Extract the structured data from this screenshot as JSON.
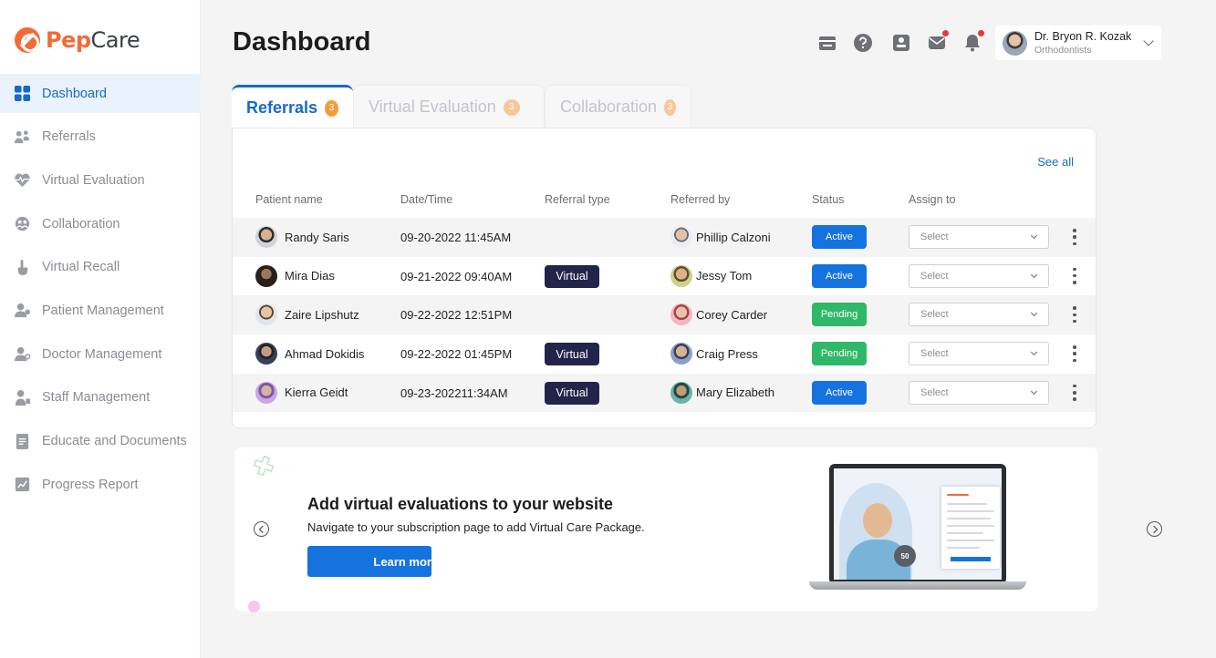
{
  "app": {
    "brand_pep": "Pep",
    "brand_care": "Care"
  },
  "sidebar": {
    "items": [
      {
        "label": "Dashboard",
        "icon": "dashboard-grid-icon",
        "active": true
      },
      {
        "label": "Referrals",
        "icon": "people-icon",
        "active": false
      },
      {
        "label": "Virtual Evaluation",
        "icon": "heart-pulse-icon",
        "active": false
      },
      {
        "label": "Collaboration",
        "icon": "collaboration-icon",
        "active": false
      },
      {
        "label": "Virtual Recall",
        "icon": "hand-pointer-icon",
        "active": false
      },
      {
        "label": "Patient Management",
        "icon": "patient-icon",
        "active": false
      },
      {
        "label": "Doctor Management",
        "icon": "doctor-icon",
        "active": false
      },
      {
        "label": "Staff Management",
        "icon": "staff-icon",
        "active": false
      },
      {
        "label": "Educate and Documents",
        "icon": "document-icon",
        "active": false
      },
      {
        "label": "Progress Report",
        "icon": "chart-icon",
        "active": false
      }
    ]
  },
  "header": {
    "title": "Dashboard",
    "icons": [
      "calendar-icon",
      "help-icon",
      "id-card-icon",
      "mail-icon",
      "bell-icon"
    ],
    "profile": {
      "name": "Dr. Bryon R. Kozak",
      "role": "Orthodontists"
    }
  },
  "tabs": [
    {
      "label": "Referrals",
      "count": "3",
      "active": true
    },
    {
      "label": "Virtual Evaluation",
      "count": "3",
      "active": false
    },
    {
      "label": "Collaboration",
      "count": "3",
      "active": false
    }
  ],
  "table": {
    "see_all": "See all",
    "columns": [
      "Patient name",
      "Date/Time",
      "Referral type",
      "Referred by",
      "Status",
      "Assign to"
    ],
    "select_placeholder": "Select",
    "rows": [
      {
        "patient": "Randy Saris",
        "date": "09-20-2022 11:45AM",
        "type": "",
        "referred_by": "Phillip Calzoni",
        "status": "Active"
      },
      {
        "patient": "Mira Dias",
        "date": "09-21-2022 09:40AM",
        "type": "Virtual",
        "referred_by": "Jessy Tom",
        "status": "Active"
      },
      {
        "patient": "Zaire Lipshutz",
        "date": "09-22-2022 12:51PM",
        "type": "",
        "referred_by": "Corey Carder",
        "status": "Pending"
      },
      {
        "patient": "Ahmad Dokidis",
        "date": "09-22-2022 01:45PM",
        "type": "Virtual",
        "referred_by": "Craig Press",
        "status": "Pending"
      },
      {
        "patient": "Kierra Geidt",
        "date": "09-23-202211:34AM",
        "type": "Virtual",
        "referred_by": "Mary Elizabeth",
        "status": "Active"
      }
    ]
  },
  "banner": {
    "title": "Add virtual evaluations to your website",
    "subtitle": "Navigate to your subscription page to add Virtual Care Package.",
    "button": "Learn mor",
    "badge": "50"
  },
  "colors": {
    "primary": "#1573e0",
    "brand_orange": "#f26b38",
    "active": "#1573e0",
    "pending": "#2fb869",
    "virtual_tag": "#22244a"
  }
}
